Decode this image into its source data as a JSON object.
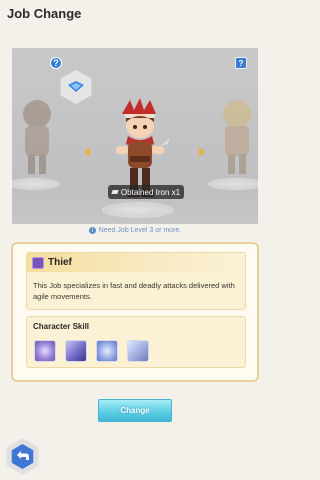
{
  "header": {
    "title": "Job Change"
  },
  "stage": {
    "help_glyph": "?",
    "hint_glyph": "?",
    "obtained_tag": "Obtained Iron x1"
  },
  "requirement": {
    "info_glyph": "i",
    "text": "Need Job Level 3 or more."
  },
  "job": {
    "name": "Thief",
    "description": "This Job specializes in fast and deadly attacks delivered with agile movements."
  },
  "skills": {
    "heading": "Character Skill",
    "icons": [
      "skill-burst-icon",
      "skill-shadow-icon",
      "skill-whirl-icon",
      "skill-stealth-icon"
    ]
  },
  "actions": {
    "change_label": "Change"
  },
  "colors": {
    "accent_blue": "#3f77d4",
    "panel_border": "#e7cf9c",
    "button_cyan": "#5fcfe6",
    "job_purple": "#7856b8"
  }
}
